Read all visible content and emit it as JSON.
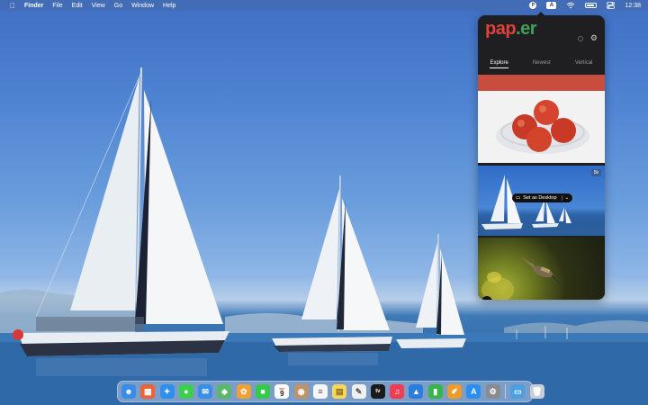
{
  "menubar": {
    "app_name": "Finder",
    "menus": [
      "File",
      "Edit",
      "View",
      "Go",
      "Window",
      "Help"
    ],
    "status": {
      "paper_glyph": "P",
      "input_source": "A",
      "time": "12:38"
    },
    "icons": [
      "apple-icon",
      "paper-menubar-icon",
      "input-source-icon",
      "wifi-icon",
      "control-center-icon",
      "battery-icon"
    ]
  },
  "popover": {
    "logo_part1": "pap",
    "logo_part2": ".er",
    "tabs": [
      {
        "label": "Explore",
        "active": true
      },
      {
        "label": "Newest",
        "active": false
      },
      {
        "label": "Vertical",
        "active": false
      }
    ],
    "resolution_badge": "5k",
    "set_desktop_label": "Set as Desktop",
    "download_glyph": "↓",
    "colors": {
      "bg": "#1f1f22",
      "logo_red": "#e0413a",
      "logo_green": "#3fa05a"
    }
  },
  "dock": {
    "calendar": {
      "month": "SEP",
      "day": "9"
    },
    "items": [
      {
        "name": "finder",
        "glyph": "☻",
        "color": "#3b8ce8"
      },
      {
        "name": "launchpad",
        "glyph": "▦",
        "color": "#e9633b"
      },
      {
        "name": "safari",
        "glyph": "✦",
        "color": "#2f8ff0"
      },
      {
        "name": "messages",
        "glyph": "●",
        "color": "#3ccf4e"
      },
      {
        "name": "mail",
        "glyph": "✉",
        "color": "#3a8ee8"
      },
      {
        "name": "maps",
        "glyph": "◆",
        "color": "#5bb86a"
      },
      {
        "name": "photos",
        "glyph": "✿",
        "color": "#f2a033"
      },
      {
        "name": "facetime",
        "glyph": "■",
        "color": "#35c94b"
      },
      {
        "name": "calendar",
        "glyph": "",
        "color": "#ffffff"
      },
      {
        "name": "contacts",
        "glyph": "◉",
        "color": "#c09366"
      },
      {
        "name": "reminders",
        "glyph": "≡",
        "color": "#f5f5f5"
      },
      {
        "name": "notes",
        "glyph": "▤",
        "color": "#f7d65a"
      },
      {
        "name": "freeform",
        "glyph": "✎",
        "color": "#f0f0f0"
      },
      {
        "name": "tv",
        "glyph": "tv",
        "color": "#1a1a1a"
      },
      {
        "name": "music",
        "glyph": "♫",
        "color": "#f33b52"
      },
      {
        "name": "keynote",
        "glyph": "▲",
        "color": "#2b7de0"
      },
      {
        "name": "numbers",
        "glyph": "▮",
        "color": "#38b54a"
      },
      {
        "name": "pages",
        "glyph": "✐",
        "color": "#f09a2a"
      },
      {
        "name": "app-store",
        "glyph": "A",
        "color": "#2a8ef2"
      },
      {
        "name": "system-settings",
        "glyph": "⚙",
        "color": "#8a8a8f"
      }
    ],
    "trailing": [
      {
        "name": "downloads-folder",
        "glyph": "▭",
        "color": "#4c9fe0"
      },
      {
        "name": "trash",
        "glyph": "🗑",
        "color": "#c8ced6"
      }
    ]
  }
}
